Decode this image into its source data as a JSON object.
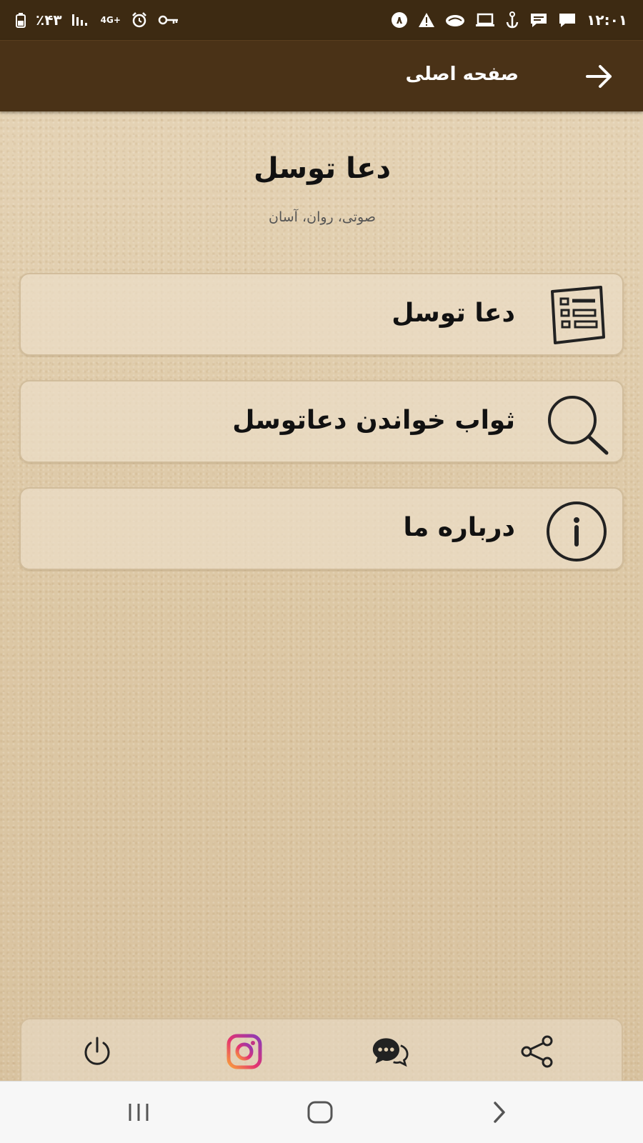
{
  "status_bar": {
    "time": "۱۲:۰۱",
    "battery": "٪۴۳",
    "network": "4G+"
  },
  "app_bar": {
    "title": "صفحه اصلی",
    "back_icon": "arrow-right-icon"
  },
  "header": {
    "title": "دعا توسل",
    "subtitle": "صوتی، روان، آسان"
  },
  "menu": {
    "items": [
      {
        "label": "دعا توسل",
        "icon": "list-icon"
      },
      {
        "label": "ثواب خواندن دعاتوسل",
        "icon": "search-icon"
      },
      {
        "label": "درباره ما",
        "icon": "info-icon"
      }
    ]
  },
  "bottom_bar": {
    "items": [
      {
        "icon": "share-icon"
      },
      {
        "icon": "chat-icon"
      },
      {
        "icon": "instagram-icon"
      },
      {
        "icon": "power-icon"
      }
    ]
  },
  "nav_bar": {
    "items": [
      {
        "icon": "recent-apps-icon"
      },
      {
        "icon": "home-icon"
      },
      {
        "icon": "back-icon"
      }
    ]
  },
  "colors": {
    "status_bar": "#3d2a12",
    "app_bar": "#4a3217",
    "paper": "#e2cfb0",
    "text": "#111111"
  }
}
